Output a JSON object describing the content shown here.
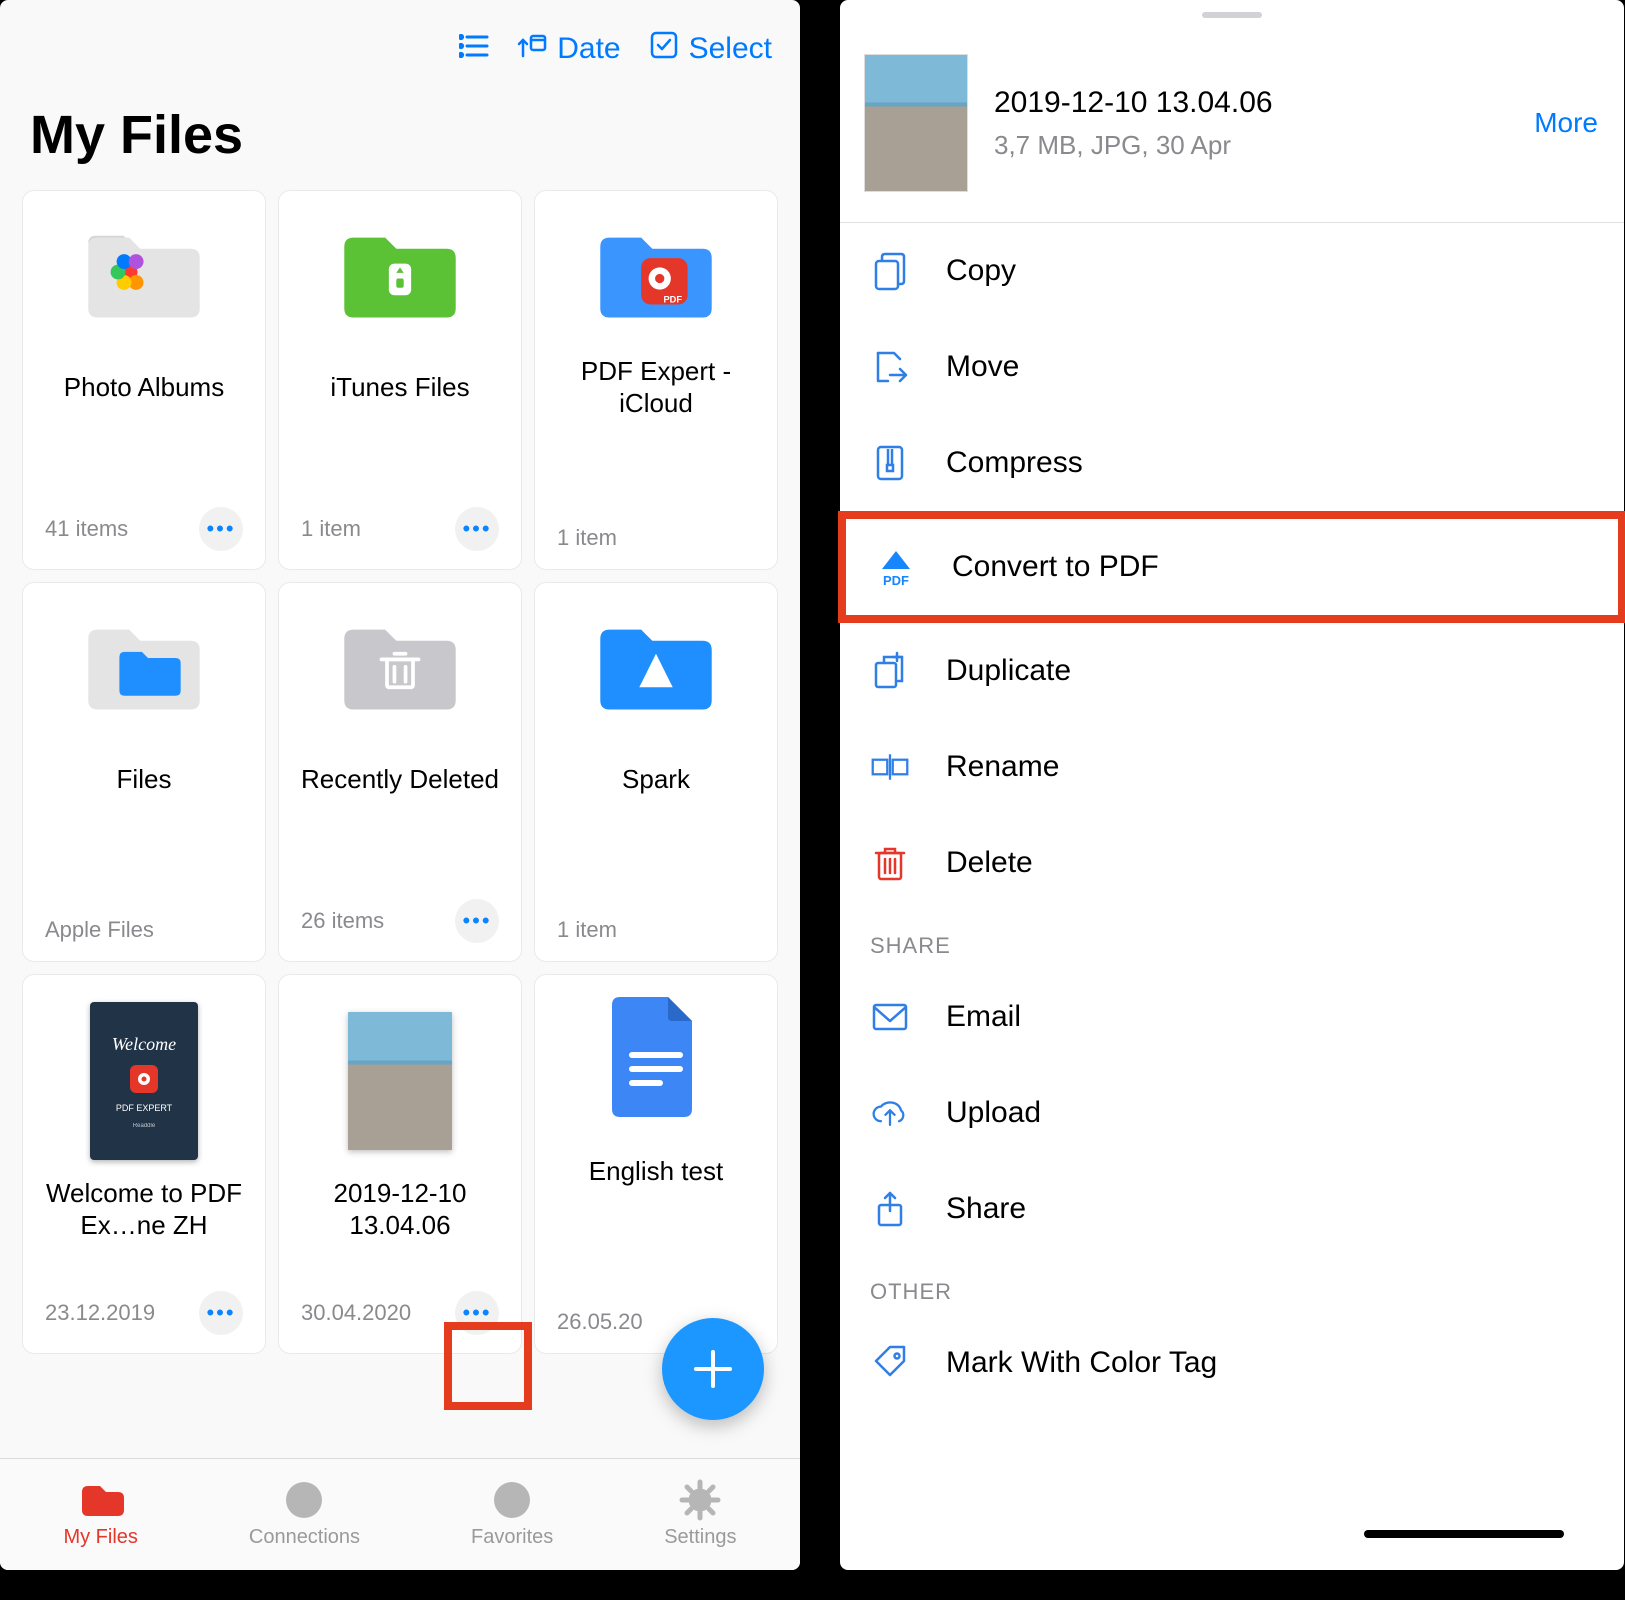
{
  "left": {
    "toolbar": {
      "sort": "Date",
      "select": "Select"
    },
    "title": "My Files",
    "tiles": [
      {
        "kind": "folder-photos",
        "name": "Photo Albums",
        "meta": "41 items",
        "more": true
      },
      {
        "kind": "folder-green",
        "name": "iTunes Files",
        "meta": "1 item",
        "more": true
      },
      {
        "kind": "folder-pdf",
        "name": "PDF Expert - iCloud",
        "meta": "1 item",
        "more": false
      },
      {
        "kind": "folder-blue",
        "name": "Files",
        "meta": "Apple Files",
        "more": false
      },
      {
        "kind": "folder-trash",
        "name": "Recently Deleted",
        "meta": "26 items",
        "more": true
      },
      {
        "kind": "folder-spark",
        "name": "Spark",
        "meta": "1 item",
        "more": false
      },
      {
        "kind": "welcome",
        "name": "Welcome to PDF Ex…ne ZH",
        "meta": "23.12.2019",
        "more": true
      },
      {
        "kind": "photo",
        "name": "2019-12-10 13.04.06",
        "meta": "30.04.2020",
        "more": true
      },
      {
        "kind": "doc",
        "name": "English test",
        "meta": "26.05.20",
        "more": false
      }
    ],
    "tabs": [
      {
        "label": "My Files",
        "active": true
      },
      {
        "label": "Connections",
        "active": false
      },
      {
        "label": "Favorites",
        "active": false
      },
      {
        "label": "Settings",
        "active": false
      }
    ]
  },
  "right": {
    "file": {
      "name": "2019-12-10 13.04.06",
      "meta": "3,7 MB, JPG, 30 Apr"
    },
    "more": "More",
    "actions": [
      {
        "label": "Copy",
        "icon": "copy-icon",
        "color": "#2f7fe6"
      },
      {
        "label": "Move",
        "icon": "move-icon",
        "color": "#2f7fe6"
      },
      {
        "label": "Compress",
        "icon": "compress-icon",
        "color": "#2f7fe6"
      },
      {
        "label": "Convert to PDF",
        "icon": "convert-pdf-icon",
        "color": "#1686ff",
        "highlight": true
      },
      {
        "label": "Duplicate",
        "icon": "duplicate-icon",
        "color": "#2f7fe6"
      },
      {
        "label": "Rename",
        "icon": "rename-icon",
        "color": "#2f7fe6"
      },
      {
        "label": "Delete",
        "icon": "delete-icon",
        "color": "#e5362a"
      }
    ],
    "share_label": "SHARE",
    "share_actions": [
      {
        "label": "Email",
        "icon": "email-icon",
        "color": "#2f7fe6"
      },
      {
        "label": "Upload",
        "icon": "upload-cloud-icon",
        "color": "#2f7fe6"
      },
      {
        "label": "Share",
        "icon": "share-icon",
        "color": "#2f7fe6"
      }
    ],
    "other_label": "OTHER",
    "other_actions": [
      {
        "label": "Mark With Color Tag",
        "icon": "tag-icon",
        "color": "#2f7fe6"
      }
    ]
  }
}
